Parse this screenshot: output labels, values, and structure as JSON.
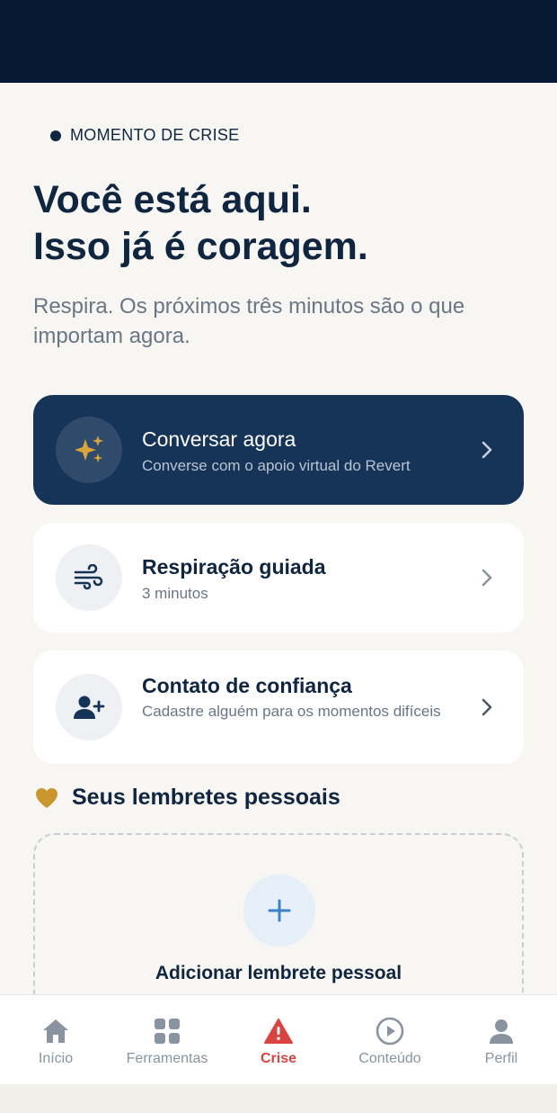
{
  "app": {
    "accent_color": "#163457",
    "alert_color": "#d94343"
  },
  "header": {
    "eyebrow": "MOMENTO DE CRISE",
    "headline_line1": "Você está aqui.",
    "headline_line2": "Isso já é coragem.",
    "subtitle": "Respira. Os próximos três minutos são o que importam agora."
  },
  "actions": [
    {
      "title": "Conversar agora",
      "subtitle": "Converse com o apoio virtual do Revert",
      "icon": "sparkles-icon"
    },
    {
      "title": "Respiração guiada",
      "subtitle": "3 minutos",
      "icon": "wind-icon"
    },
    {
      "title": "Contato de confiança",
      "subtitle": "Cadastre alguém para os momentos difíceis",
      "icon": "user-plus-icon"
    }
  ],
  "reminders": {
    "title": "Seus lembretes pessoais",
    "add_label": "Adicionar lembrete pessoal"
  },
  "tabbar": {
    "items": [
      {
        "label": "Início",
        "icon": "home-icon"
      },
      {
        "label": "Ferramentas",
        "icon": "grid-icon"
      },
      {
        "label": "Crise",
        "icon": "warning-icon",
        "active": true
      },
      {
        "label": "Conteúdo",
        "icon": "play-circle-icon"
      },
      {
        "label": "Perfil",
        "icon": "user-icon"
      }
    ]
  }
}
